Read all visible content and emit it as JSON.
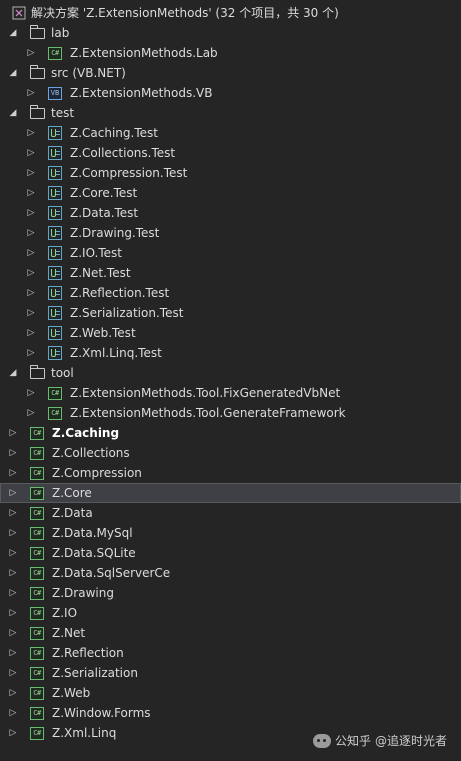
{
  "solution": {
    "label": "解决方案 'Z.ExtensionMethods' (32 个项目，共 30 个)",
    "icon": "solution-icon"
  },
  "colors": {
    "background": "#252526",
    "text": "#dcdcdc",
    "selection": "#3f3f46",
    "csharp_icon": "#69b96e",
    "vb_icon": "#6fa3dd",
    "test_icon": "#5fa8c8"
  },
  "tree": {
    "lab": {
      "label": "lab",
      "children": [
        "Z.ExtensionMethods.Lab"
      ]
    },
    "src": {
      "label": "src (VB.NET)",
      "children": [
        "Z.ExtensionMethods.VB"
      ]
    },
    "test": {
      "label": "test",
      "children": [
        "Z.Caching.Test",
        "Z.Collections.Test",
        "Z.Compression.Test",
        "Z.Core.Test",
        "Z.Data.Test",
        "Z.Drawing.Test",
        "Z.IO.Test",
        "Z.Net.Test",
        "Z.Reflection.Test",
        "Z.Serialization.Test",
        "Z.Web.Test",
        "Z.Xml.Linq.Test"
      ]
    },
    "tool": {
      "label": "tool",
      "children": [
        "Z.ExtensionMethods.Tool.FixGeneratedVbNet",
        "Z.ExtensionMethods.Tool.GenerateFramework"
      ]
    },
    "projects": [
      "Z.Caching",
      "Z.Collections",
      "Z.Compression",
      "Z.Core",
      "Z.Data",
      "Z.Data.MySql",
      "Z.Data.SQLite",
      "Z.Data.SqlServerCe",
      "Z.Drawing",
      "Z.IO",
      "Z.Net",
      "Z.Reflection",
      "Z.Serialization",
      "Z.Web",
      "Z.Window.Forms",
      "Z.Xml.Linq"
    ],
    "bold_project": "Z.Caching",
    "selected_project": "Z.Core"
  },
  "icon_labels": {
    "csharp": "C#",
    "vb": "VB"
  },
  "watermark": {
    "platform": "公知乎",
    "author": "@追逐时光者"
  }
}
